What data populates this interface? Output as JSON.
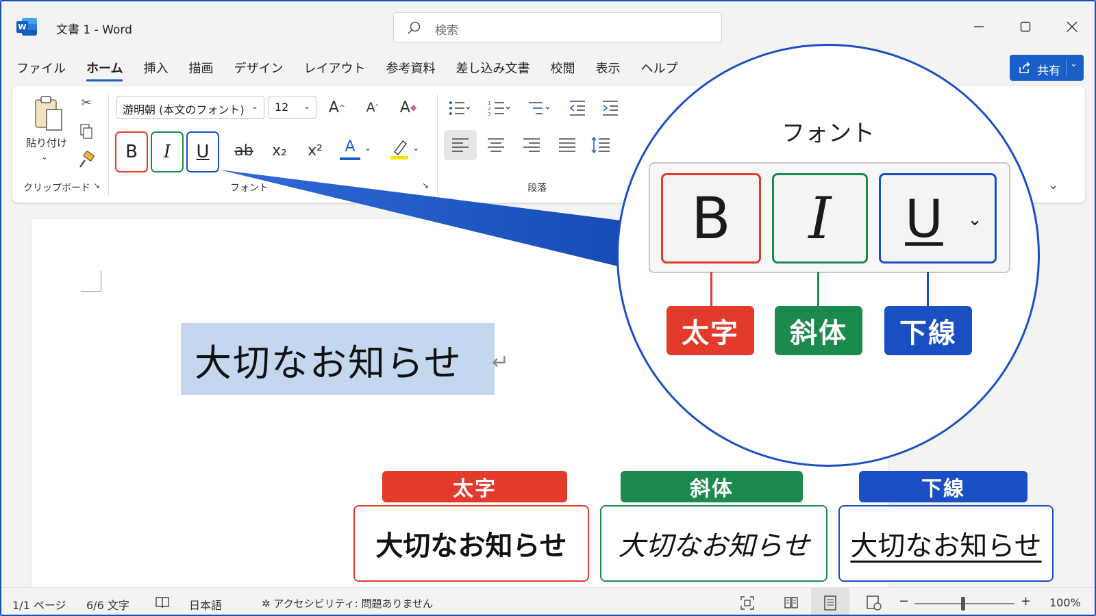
{
  "titlebar": {
    "doc_title": "文書 1  -  Word",
    "search_placeholder": "検索"
  },
  "menu": {
    "tabs": [
      "ファイル",
      "ホーム",
      "挿入",
      "描画",
      "デザイン",
      "レイアウト",
      "参考資料",
      "差し込み文書",
      "校閲",
      "表示",
      "ヘルプ"
    ],
    "active_tab": "ホーム",
    "share_label": "共有"
  },
  "ribbon": {
    "clipboard": {
      "paste_label": "貼り付け",
      "group_label": "クリップボード"
    },
    "font": {
      "font_name": "游明朝 (本文のフォント)",
      "font_size": "12",
      "bold": "B",
      "italic": "I",
      "underline": "U",
      "strike": "ab",
      "subscript": "x₂",
      "superscript": "x²",
      "font_color": "A",
      "grow": "A",
      "shrink": "A",
      "group_label": "フォント"
    },
    "paragraph": {
      "group_label": "段落"
    }
  },
  "document": {
    "text": "大切なお知らせ",
    "paragraph_mark": "↵"
  },
  "zoom_callout": {
    "title": "フォント",
    "buttons": {
      "bold": "B",
      "italic": "I",
      "underline": "U"
    },
    "labels": {
      "bold": "太字",
      "italic": "斜体",
      "underline": "下線"
    }
  },
  "examples": [
    {
      "tag": "太字",
      "text": "大切なお知らせ",
      "color": "#e23a2b"
    },
    {
      "tag": "斜体",
      "text": "大切なお知らせ",
      "color": "#1c8a4c"
    },
    {
      "tag": "下線",
      "text": "大切なお知らせ",
      "color": "#1a4fc4"
    }
  ],
  "status": {
    "page": "1/1 ページ",
    "words": "6/6 文字",
    "language": "日本語",
    "accessibility": "アクセシビリティ: 問題ありません",
    "zoom": "100%"
  },
  "colors": {
    "bold_red": "#e23a2b",
    "italic_green": "#1c8a4c",
    "underline_blue": "#1a4fc4",
    "selection": "#c3d8ef"
  }
}
